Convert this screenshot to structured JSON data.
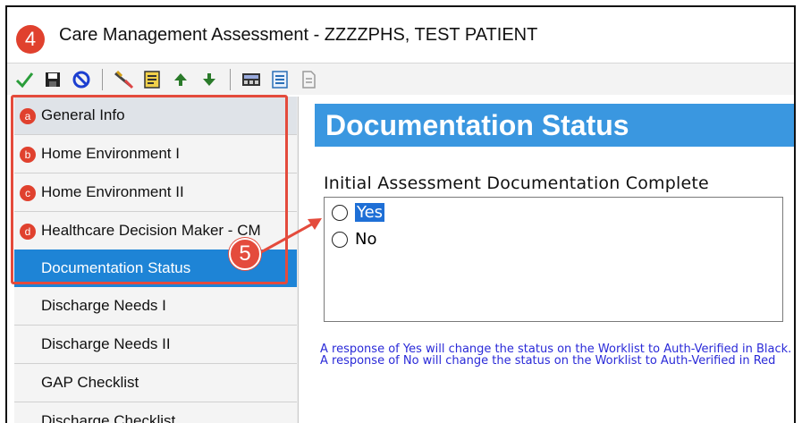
{
  "window": {
    "step_badge": "4",
    "title": "Care Management Assessment - ZZZZPHS, TEST PATIENT"
  },
  "toolbar": {
    "buttons": [
      {
        "name": "checkmark-icon",
        "color": "#2a9d3a"
      },
      {
        "name": "save-icon",
        "color": "#222222"
      },
      {
        "name": "cancel-icon",
        "color": "#1c3fd0"
      },
      {
        "name": "edit-tools-icon",
        "color": "#444444"
      },
      {
        "name": "form-icon",
        "color": "#d4a017"
      },
      {
        "name": "arrow-up-icon",
        "color": "#2a7a2a"
      },
      {
        "name": "arrow-down-icon",
        "color": "#2a7a2a"
      },
      {
        "name": "calculator-icon",
        "color": "#333333"
      },
      {
        "name": "list-icon",
        "color": "#2a6fb8"
      },
      {
        "name": "document-icon",
        "color": "#9a9a9a"
      }
    ]
  },
  "sidebar": {
    "items": [
      {
        "badge": "a",
        "label": "General Info"
      },
      {
        "badge": "b",
        "label": "Home Environment I"
      },
      {
        "badge": "c",
        "label": "Home Environment II"
      },
      {
        "badge": "d",
        "label": "Healthcare Decision Maker - CM"
      },
      {
        "badge": "",
        "label": "Documentation Status"
      },
      {
        "badge": "",
        "label": "Discharge Needs I"
      },
      {
        "badge": "",
        "label": "Discharge Needs II"
      },
      {
        "badge": "",
        "label": "GAP Checklist"
      },
      {
        "badge": "",
        "label": "Discharge Checklist"
      }
    ],
    "active_index": 4
  },
  "callout": {
    "label": "5",
    "color": "#e44b3c"
  },
  "content": {
    "header": "Documentation Status",
    "question": "Initial Assessment Documentation Complete",
    "options": [
      "Yes",
      "No"
    ],
    "selected_option": "Yes",
    "help_text": "A response of Yes will change the status on the Worklist to Auth-Verified in Black. A response of No will change the status on the Worklist to Auth-Verified in Red"
  },
  "colors": {
    "accent": "#1e84d6",
    "header_bg": "#3a97e0",
    "badge_red": "#e0412e",
    "help_text": "#2a2ad8"
  }
}
